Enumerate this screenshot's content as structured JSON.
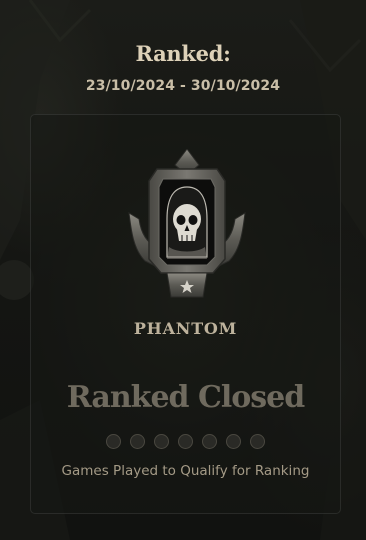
{
  "header": {
    "title": "Ranked:",
    "date_range": "23/10/2024 - 30/10/2024"
  },
  "rank": {
    "name": "PHANTOM",
    "emblem_icon": "phantom-skull-emblem-icon"
  },
  "status": {
    "title": "Ranked Closed",
    "games_played": 0,
    "games_required": 7,
    "qualify_label": "Games Played to Qualify for Ranking"
  },
  "colors": {
    "title_text": "#ddd1b8",
    "rank_name_text": "#bdb29c",
    "status_text": "#6f6a5e",
    "background": "#151613"
  }
}
